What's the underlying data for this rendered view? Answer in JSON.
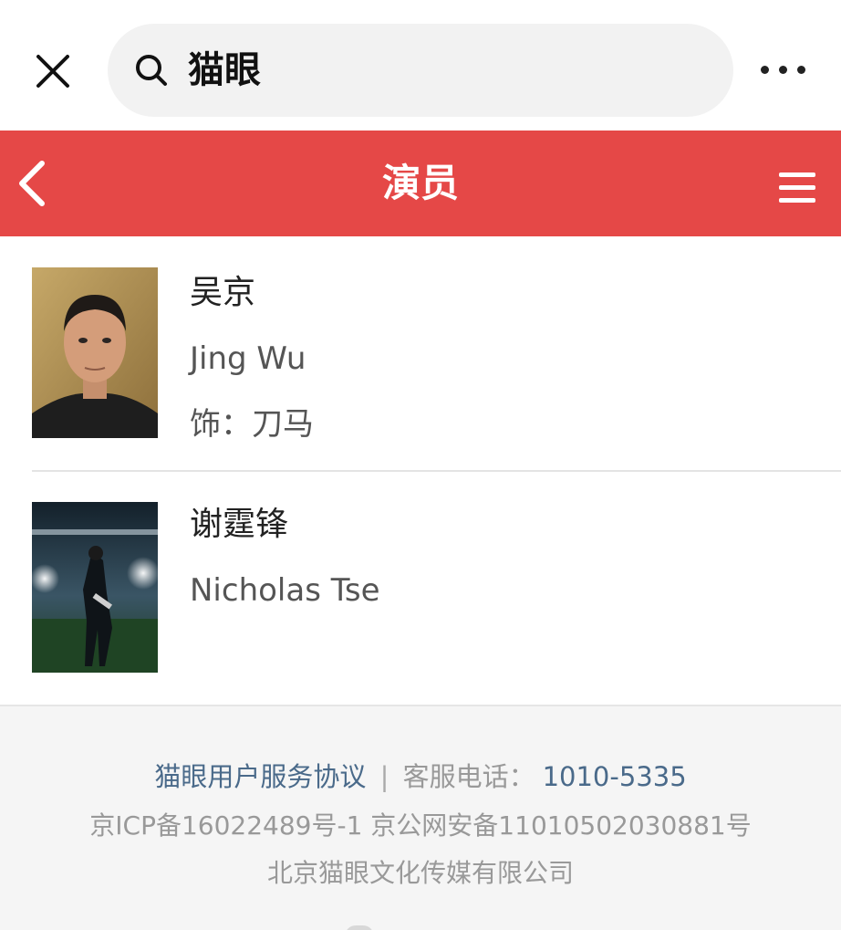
{
  "browser": {
    "search_text": "猫眼",
    "icons": {
      "close": "close-icon",
      "search": "search-icon",
      "more": "more-dots-icon"
    }
  },
  "header": {
    "title": "演员",
    "bg_color": "#e54847",
    "icons": {
      "back": "back-chevron-icon",
      "menu": "hamburger-menu-icon"
    }
  },
  "actors": [
    {
      "name_cn": "吴京",
      "name_en": "Jing Wu",
      "role": "饰：刀马"
    },
    {
      "name_cn": "谢霆锋",
      "name_en": "Nicholas Tse"
    }
  ],
  "footer": {
    "agreement_link": "猫眼用户服务协议",
    "separator": "|",
    "service_phone_label": "客服电话：",
    "service_phone": "1010-5335",
    "icp_line": "京ICP备16022489号-1 京公网安备11010502030881号",
    "company": "北京猫眼文化传媒有限公司"
  }
}
